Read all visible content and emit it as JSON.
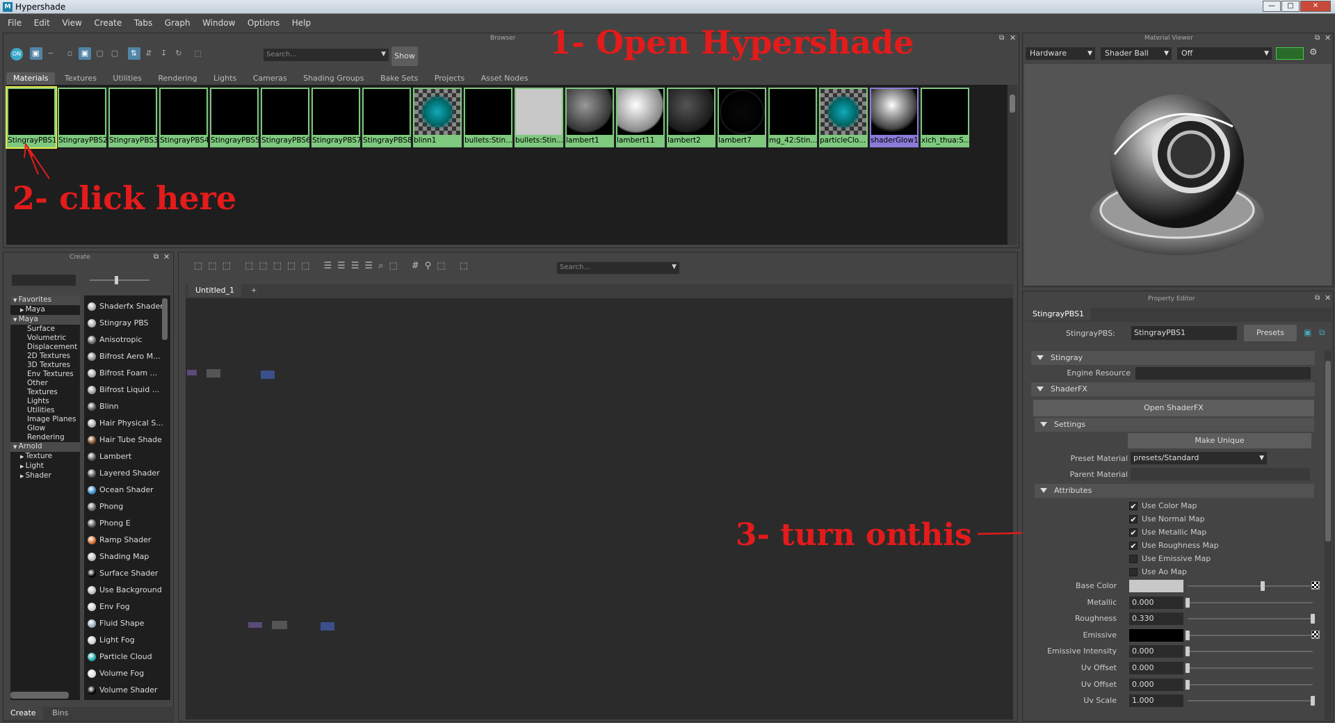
{
  "window": {
    "title": "Hypershade",
    "controls": [
      "—",
      "□",
      "✕"
    ]
  },
  "menu": [
    "File",
    "Edit",
    "View",
    "Create",
    "Tabs",
    "Graph",
    "Window",
    "Options",
    "Help"
  ],
  "browser": {
    "header": "Browser",
    "search_placeholder": "Search...",
    "show_label": "Show",
    "tabs": [
      "Materials",
      "Textures",
      "Utilities",
      "Rendering",
      "Lights",
      "Cameras",
      "Shading Groups",
      "Bake Sets",
      "Projects",
      "Asset Nodes"
    ],
    "materials": [
      {
        "name": "StingrayPBS1",
        "kind": "black",
        "selected": true
      },
      {
        "name": "StingrayPBS2",
        "kind": "black"
      },
      {
        "name": "StingrayPBS3",
        "kind": "black"
      },
      {
        "name": "StingrayPBS4",
        "kind": "black"
      },
      {
        "name": "StingrayPBS5",
        "kind": "black"
      },
      {
        "name": "StingrayPBS6",
        "kind": "black"
      },
      {
        "name": "StingrayPBS7",
        "kind": "black"
      },
      {
        "name": "StingrayPBS8",
        "kind": "black"
      },
      {
        "name": "blinn1",
        "kind": "checker"
      },
      {
        "name": "bullets:Stin...",
        "kind": "black"
      },
      {
        "name": "bullets:Stin...",
        "kind": "white"
      },
      {
        "name": "lambert1",
        "kind": "grayball"
      },
      {
        "name": "lambert11",
        "kind": "whiteball"
      },
      {
        "name": "lambert2",
        "kind": "darkball"
      },
      {
        "name": "lambert7",
        "kind": "blackball"
      },
      {
        "name": "mg_42:Stin...",
        "kind": "black"
      },
      {
        "name": "particleClo...",
        "kind": "checker"
      },
      {
        "name": "shaderGlow1",
        "kind": "glow",
        "purple": true
      },
      {
        "name": "xich_thua:S...",
        "kind": "black"
      }
    ]
  },
  "annotations": {
    "step1": "1-  Open Hypershade",
    "step2": "2- click here",
    "step3a": "3- turn on",
    "step3b": "this"
  },
  "material_viewer": {
    "header": "Material Viewer",
    "renderer": "Hardware",
    "geometry": "Shader Ball",
    "env": "Off"
  },
  "create_panel": {
    "header": "Create",
    "bottom_tabs": [
      "Create",
      "Bins"
    ],
    "tree": [
      {
        "label": "Favorites",
        "level": 0,
        "arrow": "down"
      },
      {
        "label": "Maya",
        "level": 1,
        "arrow": "right"
      },
      {
        "label": "Maya",
        "level": 0,
        "arrow": "down"
      },
      {
        "label": "Surface",
        "level": 2
      },
      {
        "label": "Volumetric",
        "level": 2
      },
      {
        "label": "Displacement",
        "level": 2
      },
      {
        "label": "2D Textures",
        "level": 2
      },
      {
        "label": "3D Textures",
        "level": 2
      },
      {
        "label": "Env Textures",
        "level": 2
      },
      {
        "label": "Other Textures",
        "level": 2
      },
      {
        "label": "Lights",
        "level": 2
      },
      {
        "label": "Utilities",
        "level": 2
      },
      {
        "label": "Image Planes",
        "level": 2
      },
      {
        "label": "Glow",
        "level": 2
      },
      {
        "label": "Rendering",
        "level": 2
      },
      {
        "label": "Arnold",
        "level": 0,
        "arrow": "down"
      },
      {
        "label": "Texture",
        "level": 1,
        "arrow": "right"
      },
      {
        "label": "Light",
        "level": 1,
        "arrow": "right"
      },
      {
        "label": "Shader",
        "level": 1,
        "arrow": "right"
      }
    ],
    "nodes": [
      {
        "label": "Shaderfx Shader",
        "color": "#aaa"
      },
      {
        "label": "Stingray PBS",
        "color": "#aaa"
      },
      {
        "label": "Anisotropic",
        "color": "#666"
      },
      {
        "label": "Bifrost Aero M...",
        "color": "#888"
      },
      {
        "label": "Bifrost Foam ...",
        "color": "#aaa"
      },
      {
        "label": "Bifrost Liquid ...",
        "color": "#999"
      },
      {
        "label": "Blinn",
        "color": "#555"
      },
      {
        "label": "Hair Physical S...",
        "color": "#aaa"
      },
      {
        "label": "Hair Tube Shade",
        "color": "#7a4a22"
      },
      {
        "label": "Lambert",
        "color": "#555"
      },
      {
        "label": "Layered Shader",
        "color": "#555"
      },
      {
        "label": "Ocean Shader",
        "color": "#3a8ac8"
      },
      {
        "label": "Phong",
        "color": "#666"
      },
      {
        "label": "Phong E",
        "color": "#555"
      },
      {
        "label": "Ramp Shader",
        "color": "#d06a2a"
      },
      {
        "label": "Shading Map",
        "color": "#bbb"
      },
      {
        "label": "Surface Shader",
        "color": "#000"
      },
      {
        "label": "Use Background",
        "color": "#bbb"
      },
      {
        "label": "Env Fog",
        "color": "#ccc"
      },
      {
        "label": "Fluid Shape",
        "color": "#9ab"
      },
      {
        "label": "Light Fog",
        "color": "#ccc"
      },
      {
        "label": "Particle Cloud",
        "color": "#2aa"
      },
      {
        "label": "Volume Fog",
        "color": "#ddd"
      },
      {
        "label": "Volume Shader",
        "color": "#000"
      }
    ]
  },
  "graph": {
    "search_placeholder": "Search...",
    "tab": "Untitled_1",
    "add_tab": "+"
  },
  "property_editor": {
    "header": "Property Editor",
    "tab": "StingrayPBS1",
    "type_label": "StingrayPBS:",
    "name_value": "StingrayPBS1",
    "presets": "Presets",
    "sections": {
      "stingray": "Stingray",
      "shaderfx": "ShaderFX",
      "settings": "Settings",
      "attributes": "Attributes"
    },
    "engine_resource_label": "Engine Resource",
    "open_shaderfx": "Open ShaderFX",
    "make_unique": "Make Unique",
    "preset_material_label": "Preset Material",
    "preset_material_value": "presets/Standard",
    "parent_material_label": "Parent Material",
    "checkboxes": [
      {
        "label": "Use Color Map",
        "checked": true
      },
      {
        "label": "Use Normal Map",
        "checked": true
      },
      {
        "label": "Use Metallic Map",
        "checked": true
      },
      {
        "label": "Use Roughness Map",
        "checked": true
      },
      {
        "label": "Use Emissive Map",
        "checked": false
      },
      {
        "label": "Use Ao Map",
        "checked": false
      }
    ],
    "attrs": [
      {
        "label": "Base Color",
        "type": "color",
        "color": "#c8c8c8",
        "level": 0.6,
        "map": true
      },
      {
        "label": "Metallic",
        "value": "0.000",
        "level": 0.0
      },
      {
        "label": "Roughness",
        "value": "0.330",
        "level": 1.0
      },
      {
        "label": "Emissive",
        "type": "color",
        "color": "#000000",
        "level": 0.0,
        "map": true
      },
      {
        "label": "Emissive Intensity",
        "value": "0.000",
        "level": 0.0
      },
      {
        "label": "Uv Offset",
        "value": "0.000",
        "level": 0.0
      },
      {
        "label": "Uv Offset",
        "value": "0.000",
        "level": 0.0
      },
      {
        "label": "Uv Scale",
        "value": "1.000",
        "level": 1.0
      }
    ]
  }
}
